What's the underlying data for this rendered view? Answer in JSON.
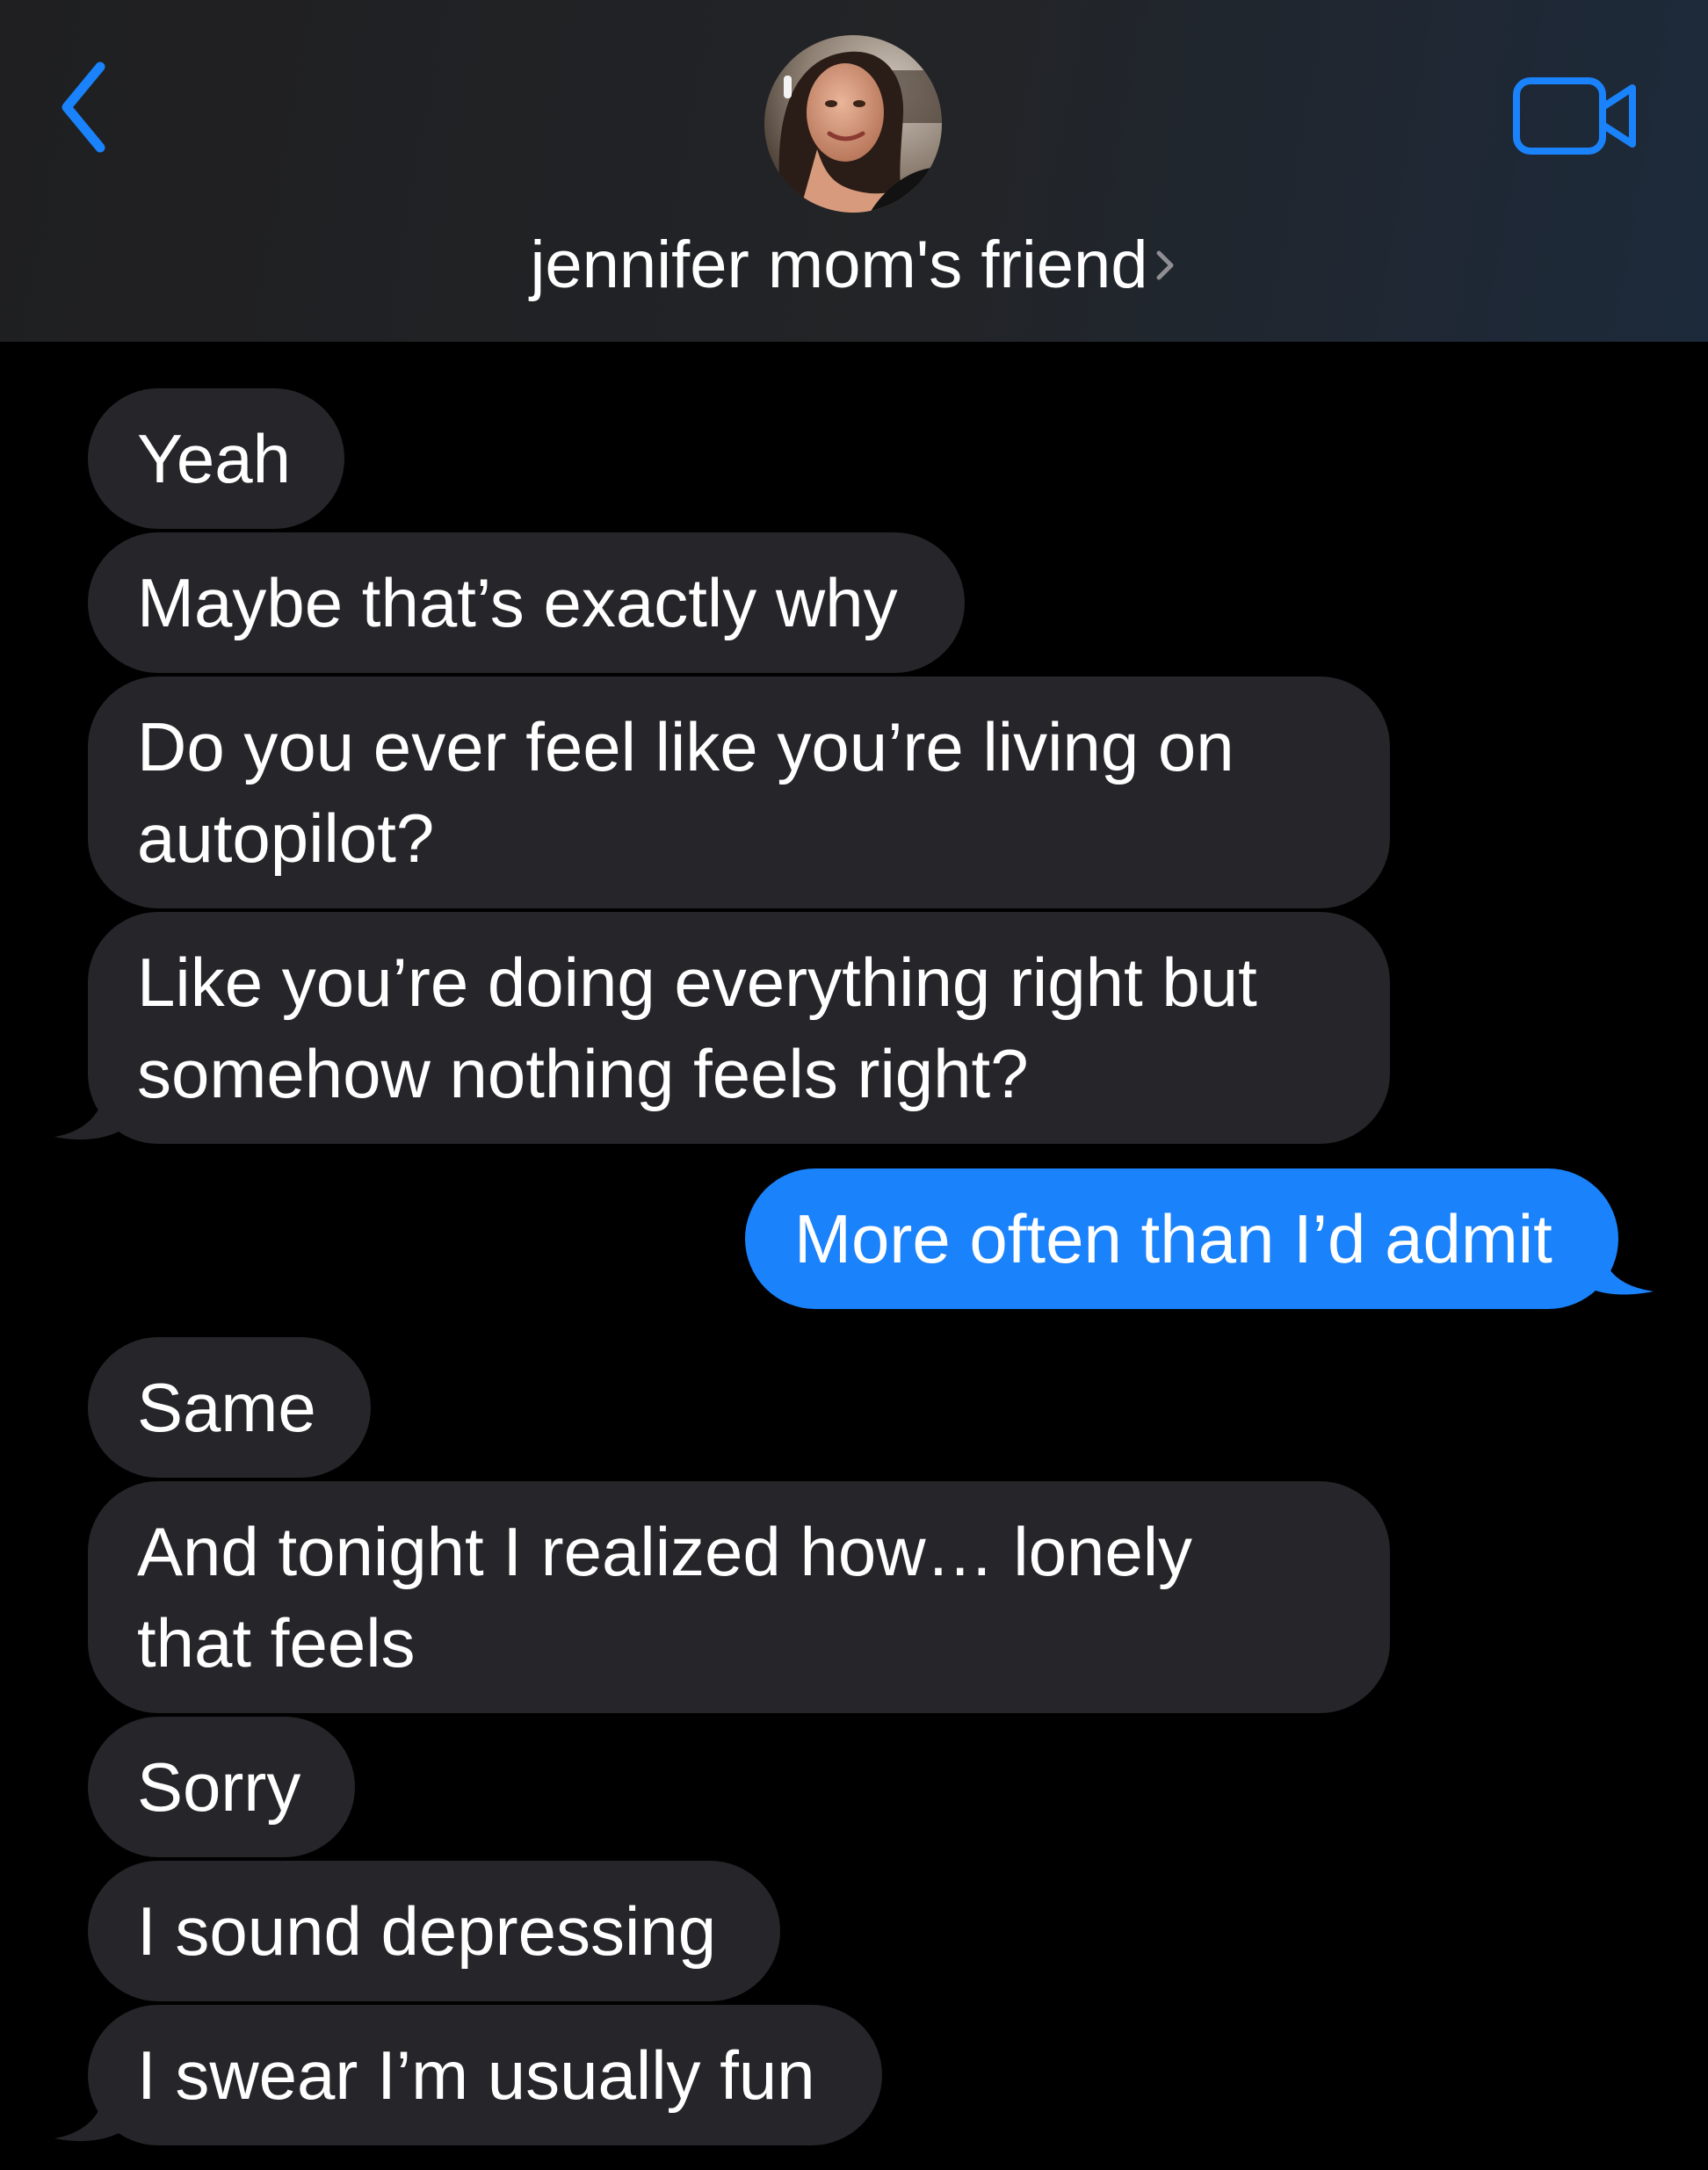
{
  "header": {
    "contact_name": "jennifer mom's friend",
    "back_icon": "chevron-left-icon",
    "video_icon": "video-camera-icon",
    "accent_color": "#1a82fb",
    "background_color": "#202124"
  },
  "thread": {
    "incoming_bubble_color": "#26252a",
    "outgoing_bubble_color": "#1a82fb",
    "messages": [
      {
        "sender": "them",
        "text": "Yeah"
      },
      {
        "sender": "them",
        "text": "Maybe that’s exactly why"
      },
      {
        "sender": "them",
        "lines": [
          "Do you ever feel like you’re living on",
          "autopilot?"
        ]
      },
      {
        "sender": "them",
        "lines": [
          "Like you’re doing everything right but",
          "somehow nothing feels right?"
        ]
      },
      {
        "sender": "me",
        "text": "More often than I’d admit"
      },
      {
        "sender": "them",
        "text": "Same"
      },
      {
        "sender": "them",
        "lines": [
          "And tonight I realized how… lonely",
          "that feels"
        ]
      },
      {
        "sender": "them",
        "text": "Sorry"
      },
      {
        "sender": "them",
        "text": "I sound depressing"
      },
      {
        "sender": "them",
        "text": "I swear I’m usually fun"
      }
    ]
  }
}
